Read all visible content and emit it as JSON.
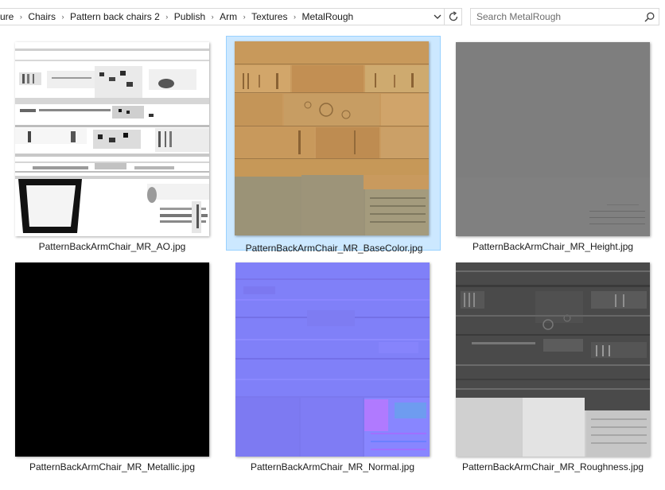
{
  "address_bar": {
    "breadcrumbs": [
      "ure",
      "Chairs",
      "Pattern back chairs 2",
      "Publish",
      "Arm",
      "Textures",
      "MetalRough"
    ]
  },
  "search": {
    "placeholder": "Search MetalRough",
    "value": ""
  },
  "files": [
    {
      "name": "PatternBackArmChair_MR_AO.jpg",
      "selected": false
    },
    {
      "name": "PatternBackArmChair_MR_BaseColor.jpg",
      "selected": true
    },
    {
      "name": "PatternBackArmChair_MR_Height.jpg",
      "selected": false
    },
    {
      "name": "PatternBackArmChair_MR_Metallic.jpg",
      "selected": false
    },
    {
      "name": "PatternBackArmChair_MR_Normal.jpg",
      "selected": false
    },
    {
      "name": "PatternBackArmChair_MR_Roughness.jpg",
      "selected": false
    }
  ],
  "colors": {
    "selection_fill": "#cce8ff",
    "selection_border": "#99d1ff",
    "basecolor_wood": "#c99a5e",
    "basecolor_fabric": "#9a9278",
    "height_gray": "#7d7d7d",
    "metallic_black": "#000000",
    "normal_blue": "#8080f8",
    "roughness_dark": "#4a4a4a"
  },
  "icons": {
    "dropdown": "chevron-down-icon",
    "refresh": "refresh-icon",
    "search": "search-icon",
    "separator": "chevron-right-icon"
  }
}
